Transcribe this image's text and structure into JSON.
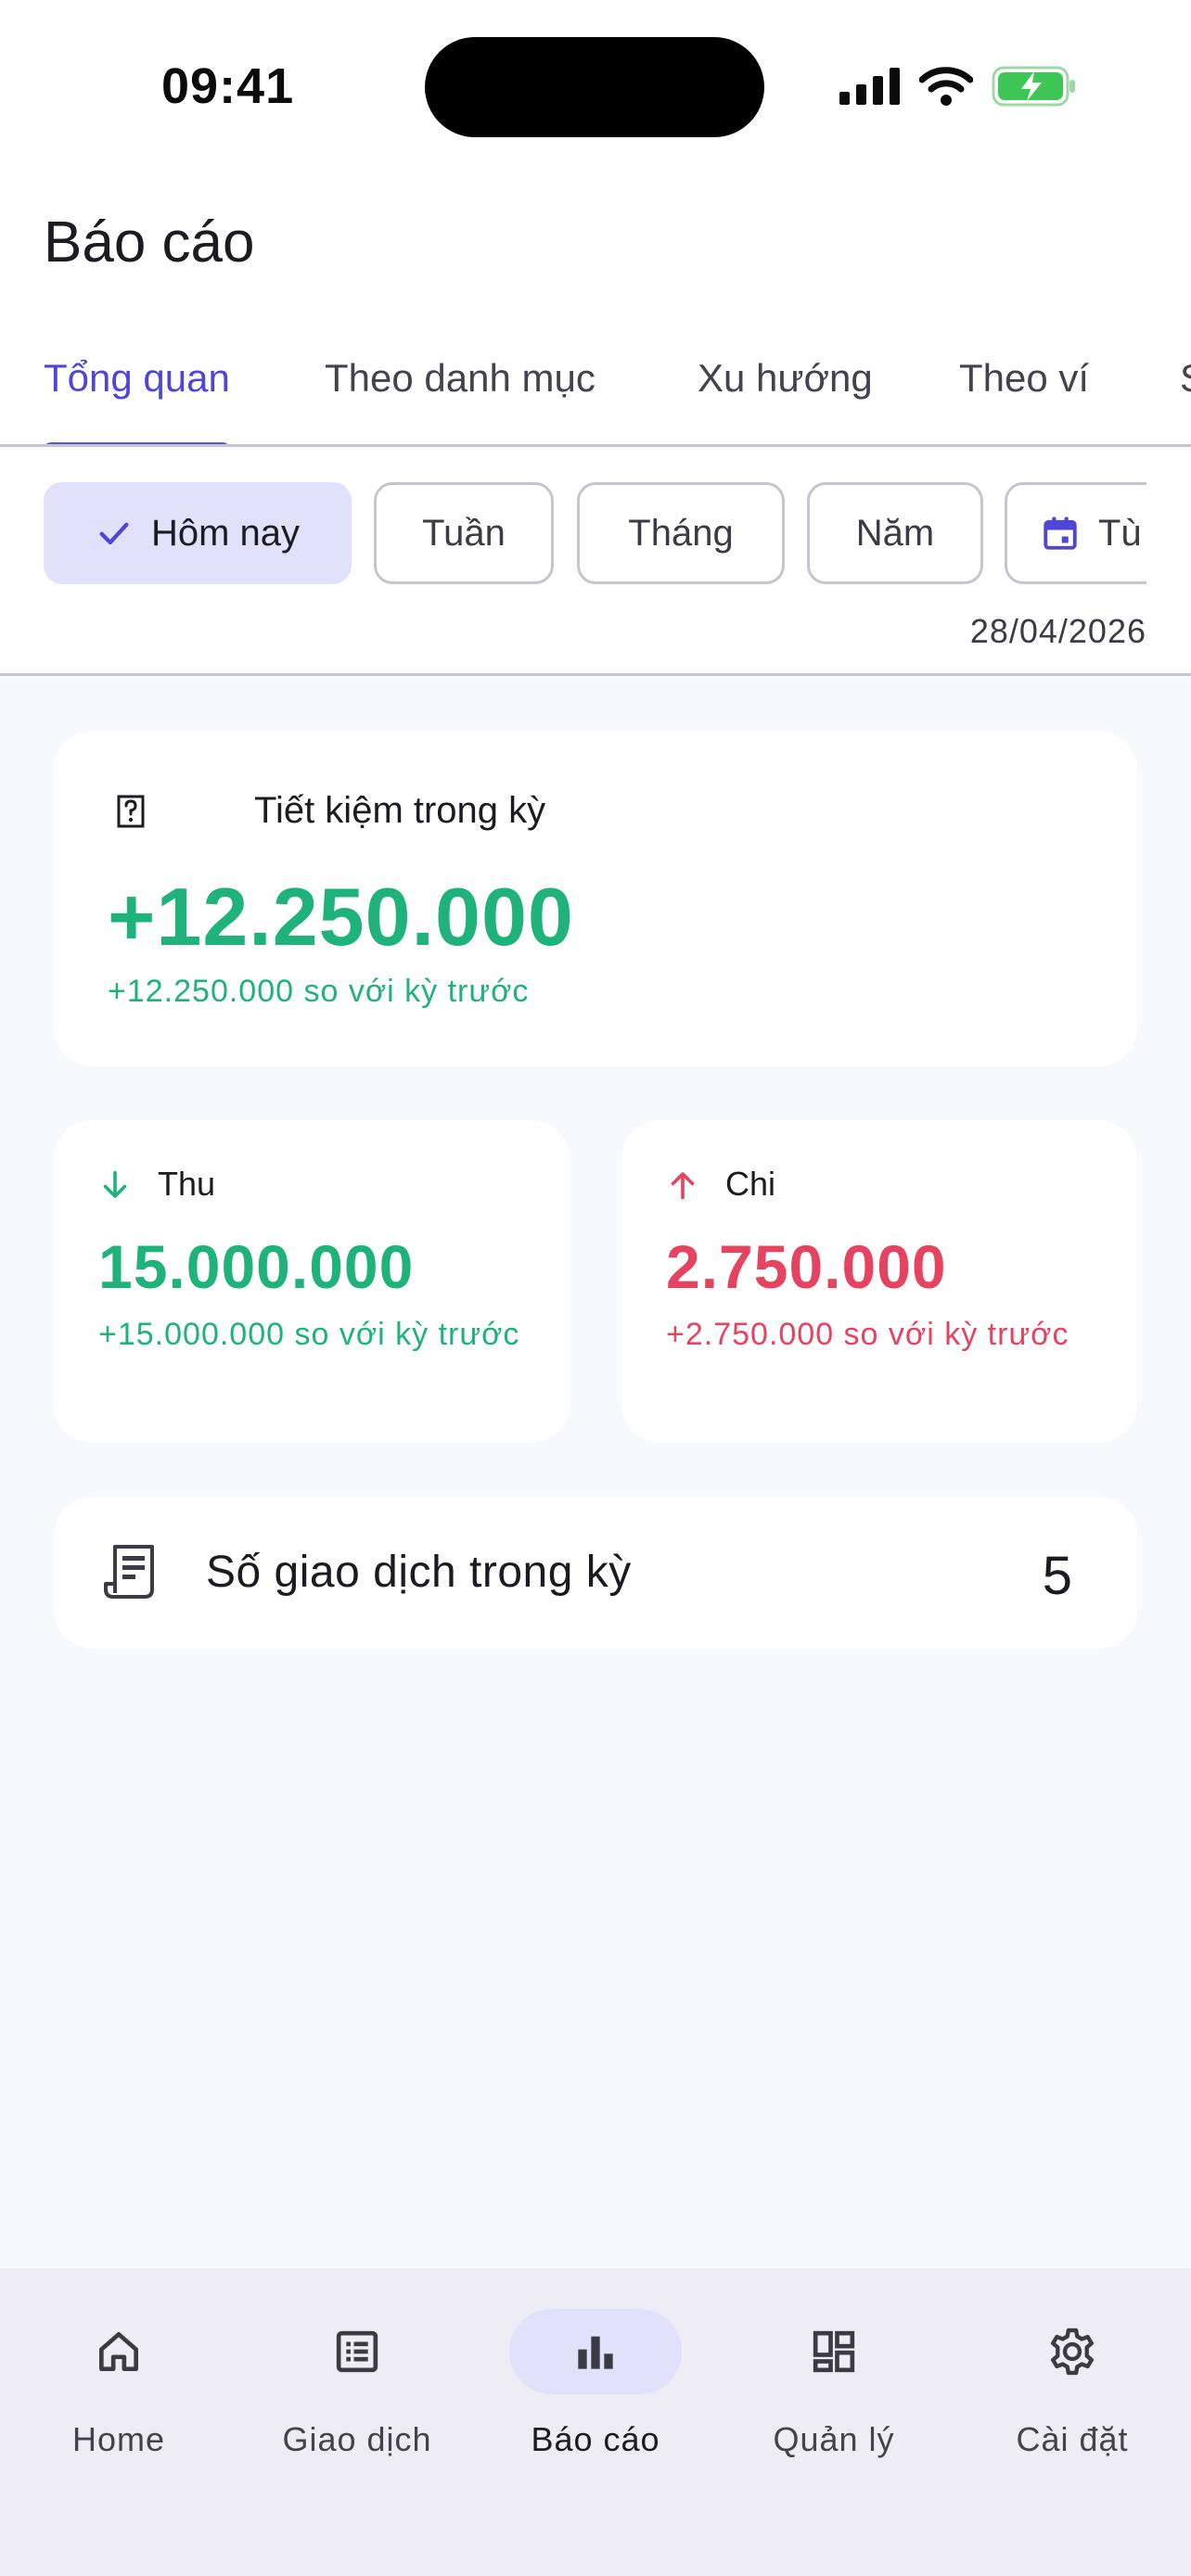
{
  "status_bar": {
    "time": "09:41"
  },
  "header": {
    "title": "Báo cáo"
  },
  "tabs": [
    {
      "label": "Tổng quan",
      "active": true
    },
    {
      "label": "Theo danh mục"
    },
    {
      "label": "Xu hướng"
    },
    {
      "label": "Theo ví"
    },
    {
      "label": "S"
    }
  ],
  "filters": {
    "chips": [
      {
        "label": "Hôm nay",
        "selected": true,
        "icon": "check-icon"
      },
      {
        "label": "Tuần"
      },
      {
        "label": "Tháng"
      },
      {
        "label": "Năm"
      },
      {
        "label": "Tù",
        "icon": "calendar-icon"
      }
    ],
    "date_range": "28/04/2026"
  },
  "savings": {
    "label": "Tiết kiệm trong kỳ",
    "value": "+12.250.000",
    "delta": "+12.250.000 so với kỳ trước",
    "icon": "unknown-icon"
  },
  "income": {
    "label": "Thu",
    "value": "15.000.000",
    "delta": "+15.000.000 so với kỳ trước",
    "icon": "arrow-down-icon"
  },
  "expense": {
    "label": "Chi",
    "value": "2.750.000",
    "delta": "+2.750.000 so với kỳ trước",
    "icon": "arrow-up-icon"
  },
  "transactions": {
    "label": "Số giao dịch trong kỳ",
    "count": "5",
    "icon": "receipt-icon"
  },
  "bottom_nav": [
    {
      "label": "Home",
      "icon": "home-icon"
    },
    {
      "label": "Giao dịch",
      "icon": "list-icon"
    },
    {
      "label": "Báo cáo",
      "icon": "bar-chart-icon",
      "active": true
    },
    {
      "label": "Quản lý",
      "icon": "dashboard-icon"
    },
    {
      "label": "Cài đặt",
      "icon": "gear-icon"
    }
  ],
  "colors": {
    "accent": "#5b52e0",
    "selected_bg": "#e2e1fb",
    "positive": "#1fb27a",
    "negative": "#e5435f"
  }
}
